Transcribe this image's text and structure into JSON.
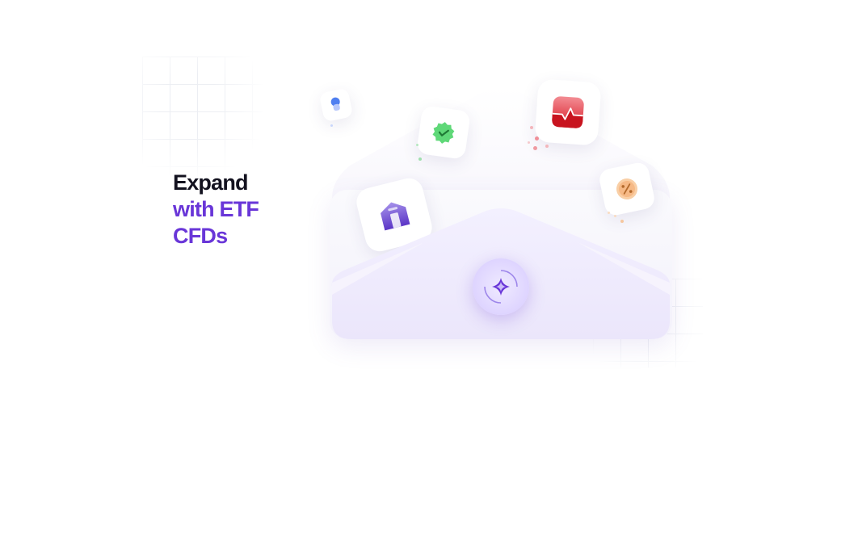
{
  "headline": {
    "line1": "Expand",
    "line2": "with ETF",
    "line3": "CFDs"
  },
  "colors": {
    "heading_dark": "#13121f",
    "accent_purple": "#6936d8",
    "envelope": "#f5f3fc",
    "check_green": "#3ec75a",
    "chart_red": "#e5323c",
    "percent_orange": "#f2b27a",
    "pin_blue": "#4f7ff0"
  },
  "icons": {
    "check": "check-badge-icon",
    "chart": "chart-card-icon",
    "percent": "percent-coin-icon",
    "pin": "pin-icon",
    "bank": "bank-icon",
    "star": "star-sparkle-icon"
  }
}
